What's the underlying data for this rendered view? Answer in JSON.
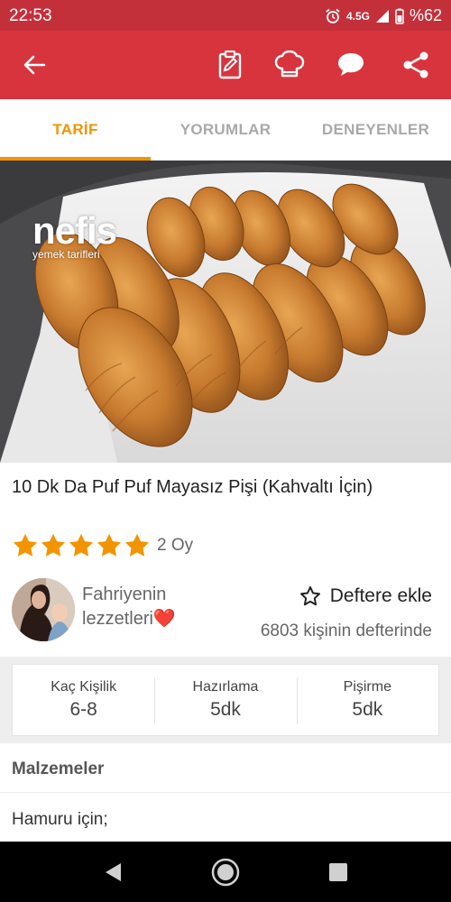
{
  "status_bar": {
    "time": "22:53",
    "network": "4.5G",
    "battery": "%62",
    "icons": [
      "alarm-icon",
      "signal-icon",
      "battery-icon"
    ]
  },
  "app_bar": {
    "background": "#d8343d",
    "icons": [
      "back-arrow-icon",
      "shopping-list-icon",
      "chef-hat-icon",
      "comment-icon",
      "share-icon"
    ]
  },
  "tabs": [
    {
      "label": "TARİF",
      "active": true
    },
    {
      "label": "YORUMLAR",
      "active": false
    },
    {
      "label": "DENEYENLER",
      "active": false
    }
  ],
  "accent_color": "#f29400",
  "hero": {
    "logo_big": "nefis",
    "logo_small": "yemek tarifleri"
  },
  "recipe": {
    "title": "10 Dk Da Puf Puf Mayasız Pişi (Kahvaltı İçin)",
    "rating_stars": 5,
    "rating_count": "2 Oy"
  },
  "author": {
    "name": "Fahriyenin lezzetleri",
    "emoji": "❤️"
  },
  "bookmark": {
    "label": "Deftere ekle",
    "count_text": "6803 kişinin defterinde"
  },
  "info": [
    {
      "label": "Kaç Kişilik",
      "value": "6-8"
    },
    {
      "label": "Hazırlama",
      "value": "5dk"
    },
    {
      "label": "Pişirme",
      "value": "5dk"
    }
  ],
  "ingredients": {
    "title": "Malzemeler",
    "first_group": "Hamuru için;"
  },
  "nav_bar": {
    "icons": [
      "back-triangle-icon",
      "home-circle-icon",
      "recents-square-icon"
    ]
  }
}
